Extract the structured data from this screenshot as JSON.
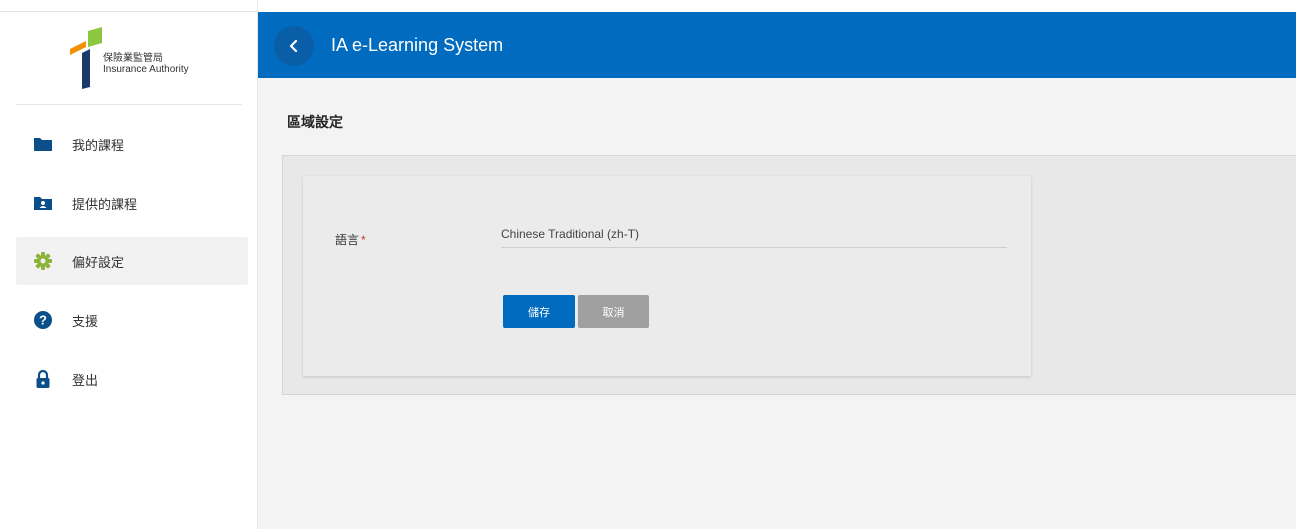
{
  "brand": {
    "name_zh": "保險業監管局",
    "name_en": "Insurance Authority"
  },
  "sidebar": {
    "items": [
      {
        "label": "我的課程",
        "icon": "folder-icon"
      },
      {
        "label": "提供的課程",
        "icon": "folder-shared-icon"
      },
      {
        "label": "偏好設定",
        "icon": "gear-icon"
      },
      {
        "label": "支援",
        "icon": "help-icon"
      },
      {
        "label": "登出",
        "icon": "lock-icon"
      }
    ],
    "active_index": 2
  },
  "header": {
    "title": "IA e-Learning System"
  },
  "main": {
    "page_title": "區域設定",
    "form": {
      "language_label": "語言",
      "required_mark": "*",
      "language_value": "Chinese Traditional (zh-T)",
      "save_label": "儲存",
      "cancel_label": "取消"
    }
  },
  "colors": {
    "primary": "#006bbf",
    "logo_orange": "#f39200",
    "logo_green": "#8dc63f",
    "logo_navy": "#1b3a6b",
    "icon_navy": "#0b4f8a",
    "icon_green": "#8cb33a",
    "cancel_gray": "#a0a0a0"
  }
}
